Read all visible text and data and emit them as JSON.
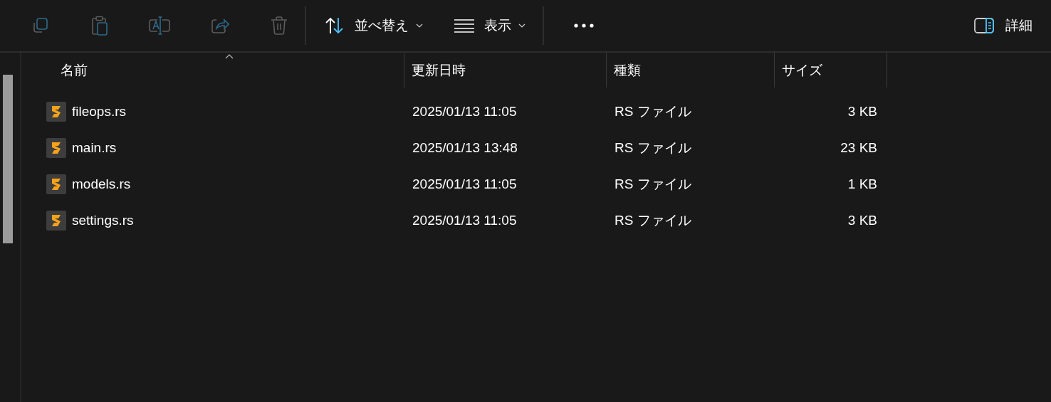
{
  "toolbar": {
    "actions": [
      {
        "kind": "copy",
        "disabled": true
      },
      {
        "kind": "paste",
        "disabled": true
      },
      {
        "kind": "rename",
        "disabled": true
      },
      {
        "kind": "share",
        "disabled": true
      },
      {
        "kind": "delete",
        "disabled": true
      }
    ],
    "sort_button": {
      "label": "並べ替え"
    },
    "view_button": {
      "label": "表示"
    },
    "details_button": {
      "label": "詳細"
    }
  },
  "columns": [
    {
      "label": "名前",
      "sorted": true
    },
    {
      "label": "更新日時",
      "sorted": false
    },
    {
      "label": "種類",
      "sorted": false
    },
    {
      "label": "サイズ",
      "sorted": false
    }
  ],
  "rows": [
    {
      "name": "fileops.rs",
      "modified": "2025/01/13 11:05",
      "type": "RS ファイル",
      "size": "3 KB"
    },
    {
      "name": "main.rs",
      "modified": "2025/01/13 13:48",
      "type": "RS ファイル",
      "size": "23 KB"
    },
    {
      "name": "models.rs",
      "modified": "2025/01/13 11:05",
      "type": "RS ファイル",
      "size": "1 KB"
    },
    {
      "name": "settings.rs",
      "modified": "2025/01/13 11:05",
      "type": "RS ファイル",
      "size": "3 KB"
    }
  ]
}
